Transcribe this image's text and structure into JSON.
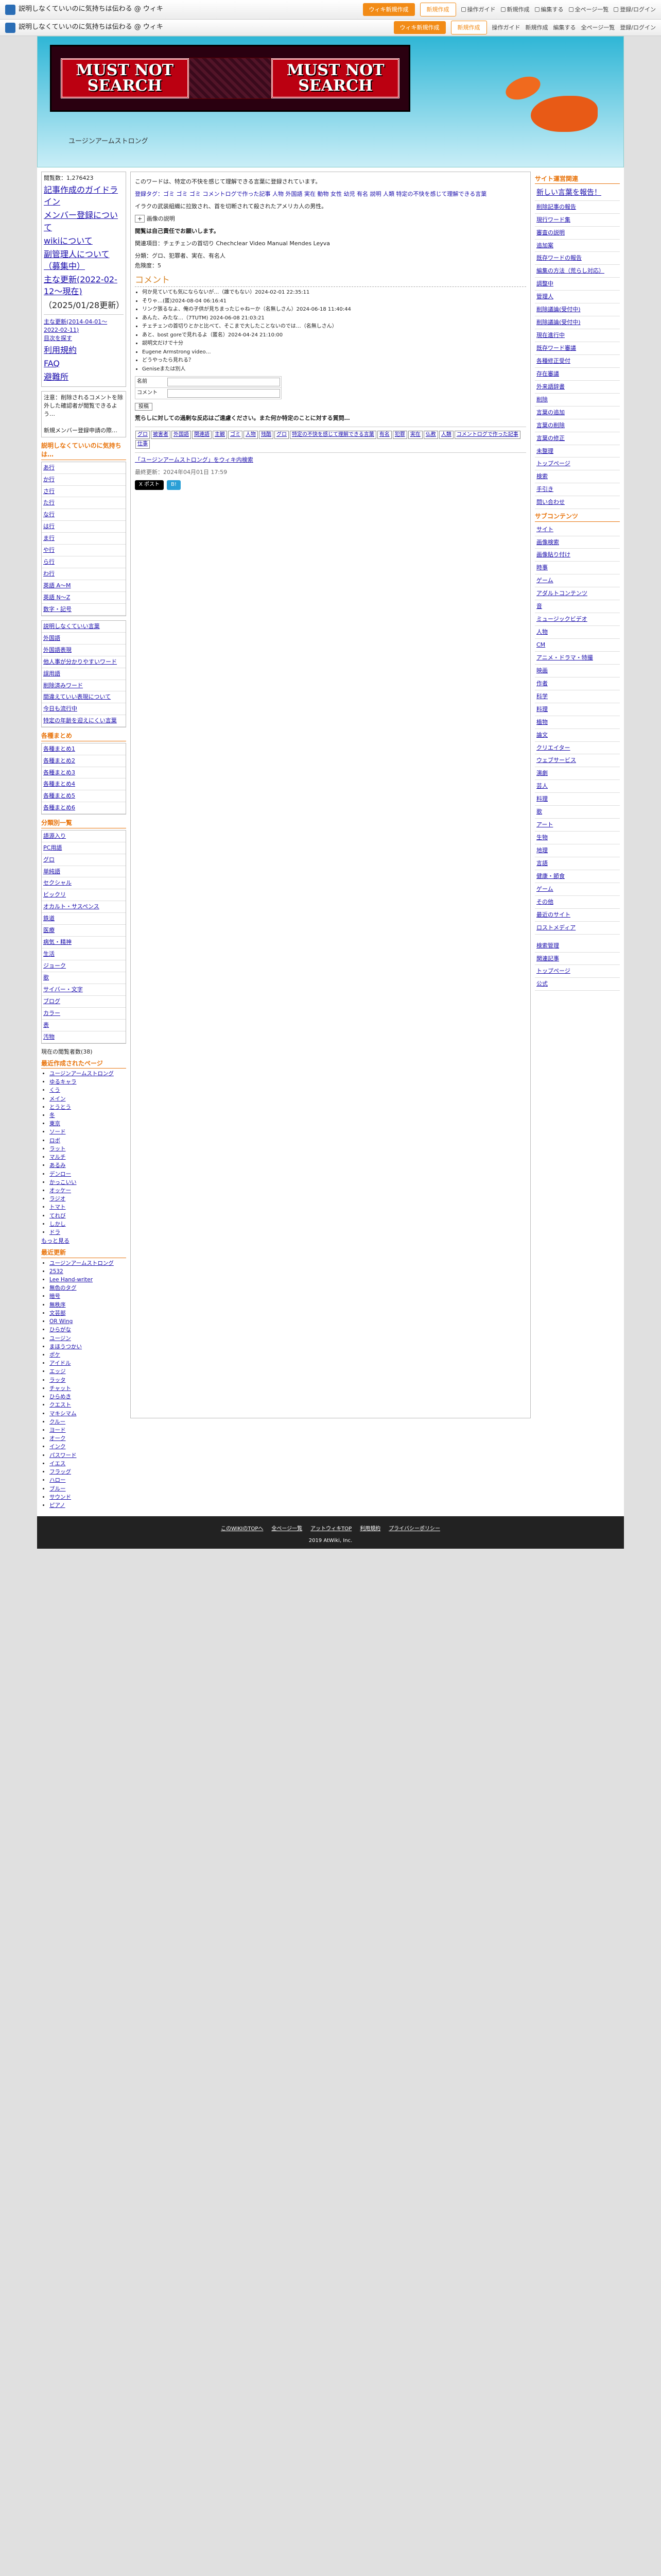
{
  "topbar": {
    "site": "説明しなくていいのに気持ちは伝わる @ ウィキ",
    "btn1": "ウィキ新規作成",
    "btn2": "新規作成",
    "tools": [
      "操作ガイド",
      "新規作成",
      "編集する",
      "全ページ一覧",
      "登録/ログイン"
    ]
  },
  "header": {
    "word_left": "MUST NOT SEARCH",
    "word_right": "MUST NOT SEARCH",
    "subtitle": "ユージンアームストロング"
  },
  "left": {
    "views": "閲覧数：1,276423",
    "nav1": "記事作成のガイドライン",
    "nav2": "メンバー登録について",
    "nav3": "wikiについて",
    "nav4": "副管理人について（募集中）",
    "nav5": "主な更新(2022-02-12～現在)",
    "nav5b": "（2025/01/28更新）",
    "upd1": "主な更新(2014-04-01～2022-02-11)",
    "upd2": "目次を探す",
    "upd3": "利用規約",
    "upd4": "FAQ",
    "upd5": "避難所",
    "note1": "注意：削除されるコメントを除外した確認者が閲覧できるよう…",
    "note2": "新規メンバー登録申請の際…",
    "sec_kana": "説明しなくていいのに気持ちは…",
    "kana": [
      "あ行",
      "か行",
      "さ行",
      "た行",
      "な行",
      "は行",
      "ま行",
      "や行",
      "ら行",
      "わ行",
      "英語 A～M",
      "英語 N～Z",
      "数字・記号"
    ],
    "group": [
      "説明しなくていい言葉",
      "外国語",
      "外国語表現",
      "他人事が分かりやすいワード",
      "誤用語",
      "削除済みワード",
      "間違えていい表現について",
      "今日も流行中",
      "特定の年齢を迎えにくい言葉"
    ],
    "sec_fav": "各種まとめ",
    "favs": [
      "各種まとめ1",
      "各種まとめ2",
      "各種まとめ3",
      "各種まとめ4",
      "各種まとめ5",
      "各種まとめ6"
    ],
    "sec_list": "分類別一覧",
    "list": [
      "語源入り",
      "PC用語",
      "グロ",
      "単純語",
      "セクシャル",
      "ビックリ",
      "オカルト・サスペンス",
      "鉄道",
      "医療",
      "病気・精神",
      "生活",
      "ジョーク",
      "歌",
      "サイバー・文字",
      "ブログ",
      "カラー",
      "表",
      "汚物"
    ],
    "counter": "現在の閲覧者数(38)",
    "sec_new": "最近作成されたページ",
    "news": [
      "ユージンアームストロング",
      "ゆるキャラ",
      "くう",
      "メイン",
      "とうとう",
      "冬",
      "東京",
      "ソード",
      "ロボ",
      "ラット",
      "マルチ",
      "あるみ",
      "デンロー",
      "かっこいい",
      "オッケー",
      "ラジオ",
      "トマト",
      "てれび",
      "しかし",
      "ドラ"
    ],
    "more": "もっと見る",
    "sec_recent": "最近更新",
    "recent": [
      "ユージンアームストロング",
      "2532",
      "Lee Hand-writer",
      "無色のタグ",
      "暗号",
      "無秩序",
      "文芸部",
      "OR Wing",
      "ひらがな",
      "ユージン",
      "まほうつかい",
      "ポケ",
      "アイドル",
      "エッジ",
      "ラッタ",
      "チャット",
      "ひらめき",
      "クエスト",
      "マキシマム",
      "クルー",
      "ヨード",
      "オーク",
      "インク",
      "パスワード",
      "イエス",
      "フラッグ",
      "ハロー",
      "ブルー",
      "サウンド",
      "ピアノ"
    ]
  },
  "main": {
    "p1": "このワードは、特定の不快を感じて理解できる言葉に登録されています。",
    "p2": "登録タグ：ゴミ ゴミ ゴミ コメントログで作った記事 人物 外国語 実在 動物 女性 幼児 有名 説明 人類 特定の不快を感じて理解できる言葉",
    "p3": "イラクの武装組織に拉致され、首を切断されて殺されたアメリカ人の男性。",
    "p4": "閲覧は自己責任でお願いします。",
    "p5": "関連項目：チェチェンの首切り Chechclear Video Manual Mendes Leyva",
    "p6": "分類：グロ、犯罪者、実在、有名人",
    "p7": "危険度：5",
    "h2": "コメント",
    "comments": [
      "何か見ていても気にならないが…（誰でもない）2024-02-01 22:35:11",
      "そりゃ…(匿)2024-08-04 06:16:41",
      "リンク張るなよ、俺の子供が見ちまったじゃねーか（名無しさん）2024-06-18 11:40:44",
      "あんた、みたな…（7TUTM) 2024-06-08 21:03:21",
      "チェチェンの首切りとかと比べて、そこまで大したことないのでは…（名無しさん）",
      "あと、bost goreで見れるよ（匿名）2024-04-24 21:10:00",
      "説明文だけで十分",
      "Eugene Armstrong video…",
      "どうやったら見れる？",
      "Geniseまたは別人"
    ],
    "name": "名前",
    "comment": "コメント",
    "send": "投稿",
    "warn": "荒らしに対しての過剰な反応はご遠慮ください。また何か特定のことに対する質問…",
    "tags": [
      "グロ",
      "被害者",
      "外国語",
      "関連語",
      "主観",
      "ゴミ",
      "人物",
      "残酷",
      "グロ",
      "特定の不快を感じて理解できる言葉",
      "有名",
      "犯罪",
      "実在",
      "仏教",
      "人類",
      "コメントログで作った記事",
      "仕事"
    ],
    "link": "「ユージンアームストロング」をウィキ内検索",
    "date": "最終更新：2024年04月01日 17:59"
  },
  "right": {
    "head1": "サイト運営関連",
    "nav": [
      "新しい言葉を報告！",
      "削除記事の報告",
      "現行ワード集",
      "審査の説明",
      "追加案",
      "既存ワードの報告",
      "編集の方法（荒らし対応）",
      "調整中",
      "管理人",
      "削除議論(受付中)",
      "削除議論(受付中)",
      "現在進行中",
      "既存ワード審議",
      "各種修正受付",
      "存在審議",
      "外来語辞書",
      "削除",
      "言葉の追加",
      "言葉の削除",
      "言葉の修正",
      "未整理",
      "トップページ",
      "検索",
      "手引き",
      "問い合わせ"
    ],
    "head2": "サブコンテンツ",
    "subs": [
      "サイト",
      "画像検索",
      "画像貼り付け",
      "時事",
      "ゲーム",
      "アダルトコンテンツ",
      "音",
      "ミュージックビデオ",
      "人物",
      "CM",
      "アニメ・ドラマ・特撮",
      "映画",
      "作者",
      "科学",
      "料理",
      "植物",
      "論文",
      "クリエイター",
      "ウェブサービス",
      "演劇",
      "芸人",
      "料理",
      "歌",
      "アート",
      "生物",
      "地理",
      "言語",
      "健康・節食",
      "ゲーム",
      "その他",
      "最近のサイト",
      "ロストメディア"
    ],
    "search": [
      "検索管理",
      "関連記事",
      "トップページ",
      "公式"
    ]
  },
  "footer": {
    "links": [
      "このWIKIのTOPへ",
      "全ページ一覧",
      "アットウィキTOP",
      "利用規約",
      "プライバシーポリシー"
    ],
    "copy": "2019 AtWiki, Inc."
  }
}
